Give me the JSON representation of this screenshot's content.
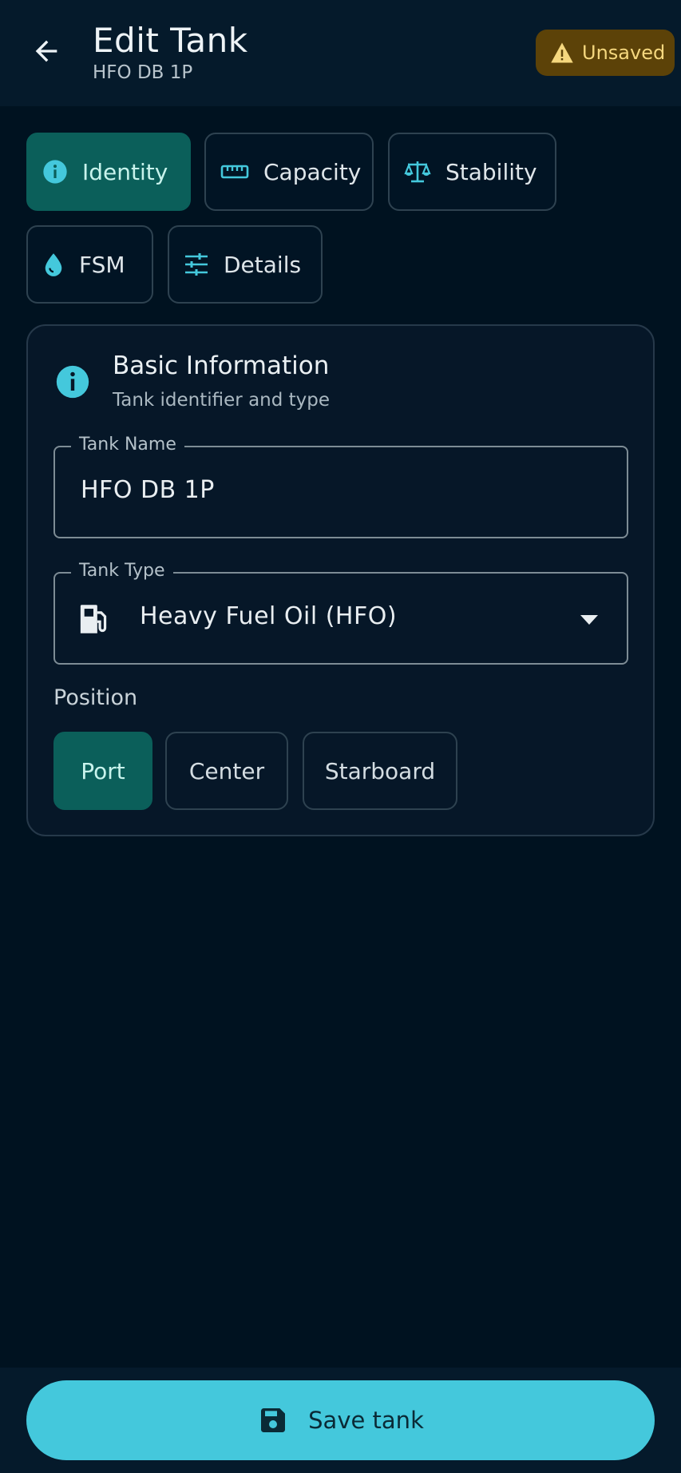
{
  "header": {
    "title": "Edit Tank",
    "subtitle": "HFO DB 1P",
    "status_badge": "Unsaved",
    "back_icon": "arrow-left-icon"
  },
  "tabs": [
    {
      "label": "Identity",
      "icon": "info-icon",
      "active": true
    },
    {
      "label": "Capacity",
      "icon": "ruler-icon",
      "active": false
    },
    {
      "label": "Stability",
      "icon": "scale-icon",
      "active": false
    },
    {
      "label": "FSM",
      "icon": "water-drop-icon",
      "active": false
    },
    {
      "label": "Details",
      "icon": "sliders-icon",
      "active": false
    }
  ],
  "card": {
    "title": "Basic Information",
    "subtitle": "Tank identifier and type",
    "tank_name": {
      "label": "Tank Name",
      "value": "HFO DB 1P"
    },
    "tank_type": {
      "label": "Tank Type",
      "value": "Heavy Fuel Oil (HFO)"
    },
    "position": {
      "label": "Position",
      "options": [
        "Port",
        "Center",
        "Starboard"
      ],
      "selected": "Port"
    }
  },
  "footer": {
    "save_label": "Save tank"
  },
  "colors": {
    "background": "#001220",
    "accent": "#44c8dc",
    "active_tab": "#0b5f5a",
    "warning_bg": "#5c4208",
    "warning_text": "#f5d77e"
  }
}
